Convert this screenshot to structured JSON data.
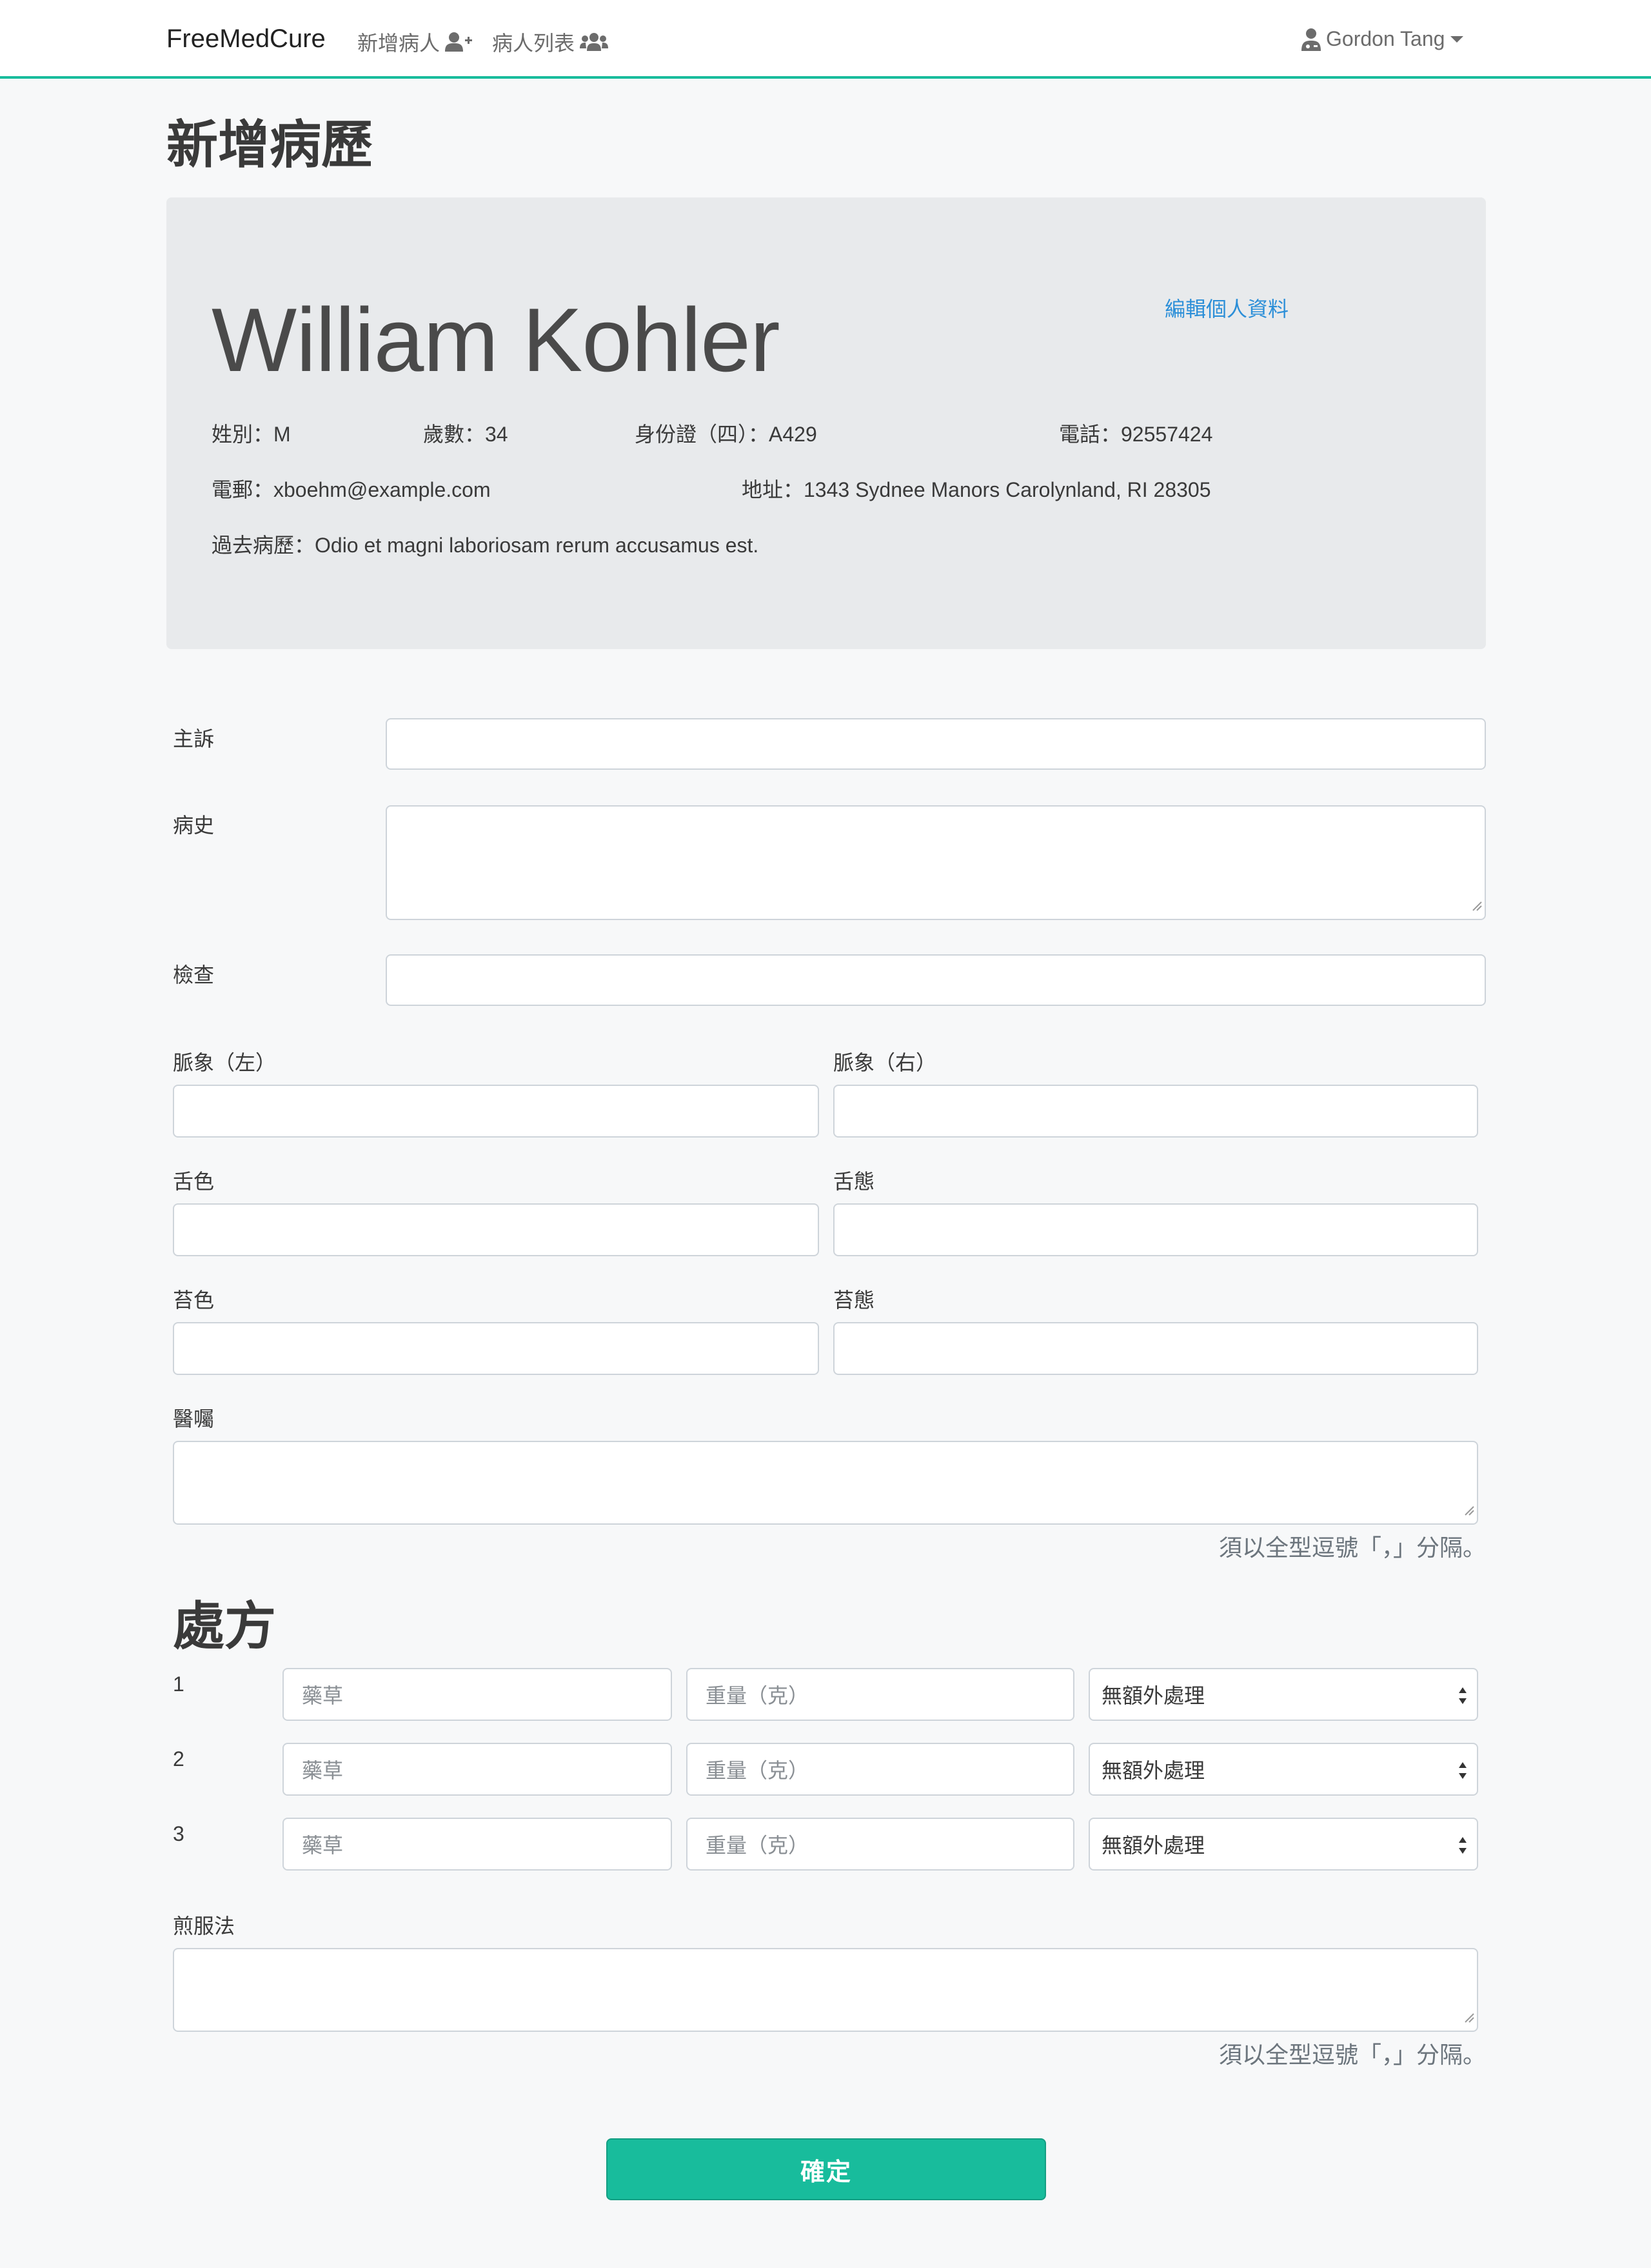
{
  "navbar": {
    "brand": "FreeMedCure",
    "add_patient": "新增病人",
    "patient_list": "病人列表",
    "user": "Gordon Tang"
  },
  "page_title": "新增病歷",
  "patient": {
    "name": "William Kohler",
    "edit_label": "編輯個人資料",
    "gender": "姓別：M",
    "age": "歲數：34",
    "id": "身份證（四）：A429",
    "phone": "電話：92557424",
    "email": "電郵：xboehm@example.com",
    "address": "地址：1343 Sydnee Manors Carolynland, RI 28305",
    "history": "過去病歷：Odio et magni laboriosam rerum accusamus est."
  },
  "form": {
    "complaint_label": "主訴",
    "history_label": "病史",
    "exam_label": "檢查",
    "pulse_left_label": "脈象（左）",
    "pulse_right_label": "脈象（右）",
    "tongue_color_label": "舌色",
    "tongue_shape_label": "舌態",
    "coating_color_label": "苔色",
    "coating_shape_label": "苔態",
    "advice_label": "醫囑",
    "advice_help": "須以全型逗號「，」分隔。",
    "prescription_title": "處方",
    "herb_placeholder": "藥草",
    "weight_placeholder": "重量（克）",
    "process_selected": "無額外處理",
    "rows": [
      "1",
      "2",
      "3"
    ],
    "decoction_label": "煎服法",
    "decoction_help": "須以全型逗號「，」分隔。",
    "submit_label": "確定"
  },
  "colors": {
    "accent": "#18bc9c",
    "link": "#2c8fd8",
    "jumbotron": "#e8eaec"
  },
  "icons": {
    "add_patient": "user-plus-icon",
    "patient_list": "users-icon",
    "user": "user-doctor-icon",
    "dropdown": "caret-down-icon"
  }
}
